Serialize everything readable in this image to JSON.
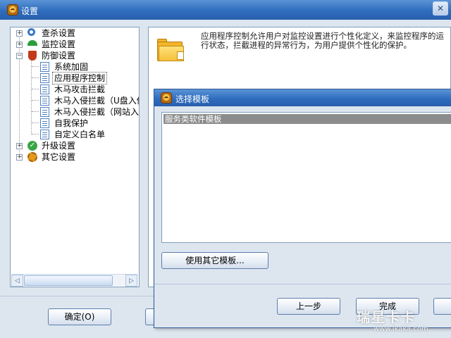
{
  "window": {
    "title": "设置",
    "close_glyph": "✕"
  },
  "tree": {
    "expander_expanded": "−",
    "expander_collapsed": "+",
    "items": [
      {
        "label": "查杀设置",
        "icon": "search-icon"
      },
      {
        "label": "监控设置",
        "icon": "umbrella-icon"
      },
      {
        "label": "防御设置",
        "icon": "shield-icon"
      },
      {
        "label": "系统加固",
        "icon": "document-icon"
      },
      {
        "label": "应用程序控制",
        "icon": "document-icon"
      },
      {
        "label": "木马攻击拦截",
        "icon": "document-icon"
      },
      {
        "label": "木马入侵拦截（U盘入侵",
        "icon": "document-icon"
      },
      {
        "label": "木马入侵拦截（网站入侵",
        "icon": "document-icon"
      },
      {
        "label": "自我保护",
        "icon": "document-icon"
      },
      {
        "label": "自定义白名单",
        "icon": "document-icon"
      },
      {
        "label": "升级设置",
        "icon": "check-icon"
      },
      {
        "label": "其它设置",
        "icon": "gear-icon"
      }
    ],
    "scroll_left_glyph": "◁",
    "scroll_right_glyph": "▷"
  },
  "content": {
    "description": "应用程序控制允许用户对监控设置进行个性化定义，来监控程序的运行状态，拦截进程的异常行为，为用户提供个性化的保护。"
  },
  "buttons": {
    "ok": "确定(O)"
  },
  "dialog": {
    "title": "选择模板",
    "templates": [
      "服务类软件模板"
    ],
    "other_template_button": "使用其它模板...",
    "prev_button": "上一步",
    "finish_button": "完成"
  },
  "watermark": {
    "text": "瑞星卡卡",
    "url": "www.ikaka.com"
  },
  "colors": {
    "titlebar": "#2f6dbd",
    "background": "#dde6ef",
    "selection": "#8c8c8c"
  }
}
